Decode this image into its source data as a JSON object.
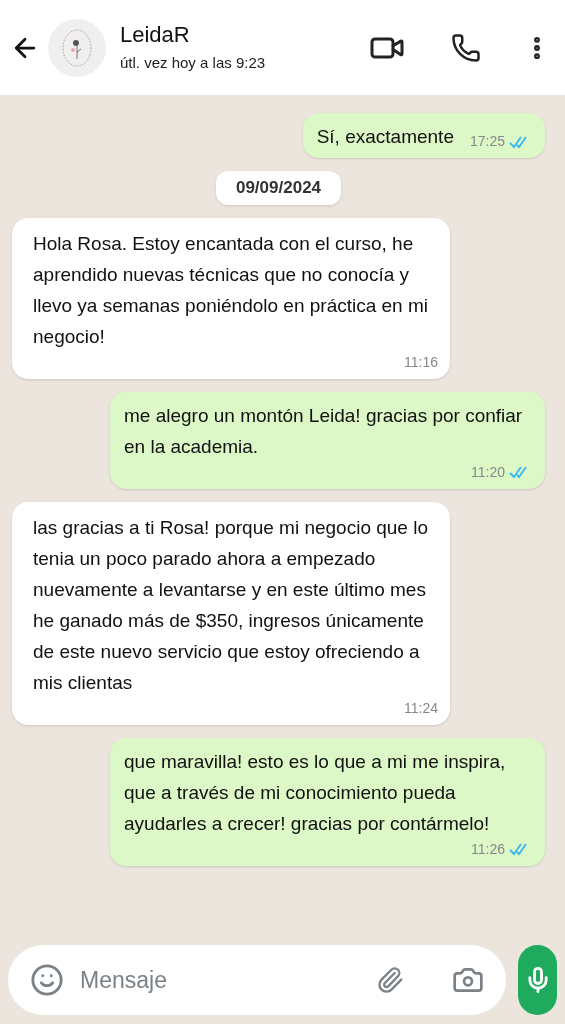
{
  "header": {
    "name": "LeidaR",
    "status": "útl. vez hoy a las 9:23"
  },
  "messages": [
    {
      "kind": "out",
      "text": "Sí, exactamente",
      "time": "17:25",
      "read": true
    },
    {
      "kind": "date",
      "text": "09/09/2024"
    },
    {
      "kind": "in",
      "text": "Hola Rosa. Estoy encantada con el curso, he aprendido nuevas técnicas que no conocía y llevo ya semanas poniéndolo en práctica en mi negocio!",
      "time": "11:16"
    },
    {
      "kind": "out",
      "text": "me alegro un montón Leida! gracias por confiar en la academia.",
      "time": "11:20",
      "read": true
    },
    {
      "kind": "in",
      "text": "las gracias a ti Rosa! porque mi negocio que lo tenia un poco parado ahora a empezado nuevamente a levantarse y en este último mes he ganado más de $350, ingresos únicamente de este nuevo servicio que estoy ofreciendo a mis clientas",
      "time": "11:24"
    },
    {
      "kind": "out",
      "text": "que maravilla! esto es lo que a mi me inspira, que a través de mi conocimiento pueda ayudarles a crecer! gracias por contármelo!",
      "time": "11:26",
      "read": true
    }
  ],
  "composer": {
    "placeholder": "Mensaje"
  }
}
